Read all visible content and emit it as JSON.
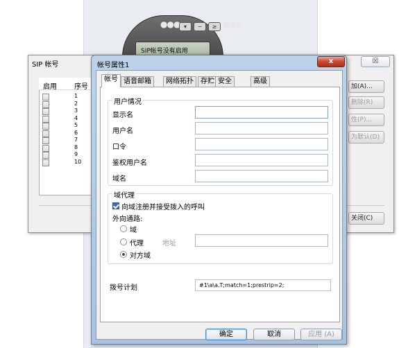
{
  "phone": {
    "screen_text": "SIP帐号没有启用",
    "dots_left": "●●●",
    "dots_right": "●●●",
    "buttons": [
      "▾",
      "−",
      "≥"
    ]
  },
  "sip_window": {
    "title": "SIP 帐号",
    "close_label": "☒",
    "columns": [
      "启用",
      "序号"
    ],
    "rows": [
      "1",
      "2",
      "3",
      "4",
      "5",
      "6",
      "7",
      "8",
      "9",
      "10"
    ],
    "side_buttons": [
      {
        "label": "加(A)...",
        "enabled": true
      },
      {
        "label": "删除(R)",
        "enabled": false
      },
      {
        "label": "性(P)...",
        "enabled": false
      },
      {
        "label": "为默认(D)",
        "enabled": false
      },
      {
        "label": "关闭(C)",
        "enabled": true
      }
    ]
  },
  "dialog": {
    "title": "帐号属性1",
    "close_label": "x",
    "tabs": [
      "帐号",
      "语音邮箱",
      "网络拓扑",
      "存贮",
      "安全",
      "高级"
    ],
    "user_group": {
      "title": "用户情况",
      "fields": [
        {
          "label": "显示名",
          "value": ""
        },
        {
          "label": "用户名",
          "value": ""
        },
        {
          "label": "口令",
          "value": ""
        },
        {
          "label": "鉴权用户名",
          "value": ""
        },
        {
          "label": "域名",
          "value": ""
        }
      ]
    },
    "proxy_group": {
      "title": "域代理",
      "register_label": "向域注册并接受拨入的呼叫",
      "register_checked": true,
      "outbound_label": "外向通路:",
      "radio_domain": "域",
      "radio_proxy": "代理",
      "address_label": "地址",
      "address_value": "",
      "radio_peer": "对方域",
      "selected": "对方域"
    },
    "dial_plan": {
      "label": "拨号计划",
      "value": "#1\\a\\a.T;match=1;prestrip=2;"
    },
    "buttons": {
      "ok": "确定",
      "cancel": "取消",
      "apply": "应用 (A)"
    }
  }
}
